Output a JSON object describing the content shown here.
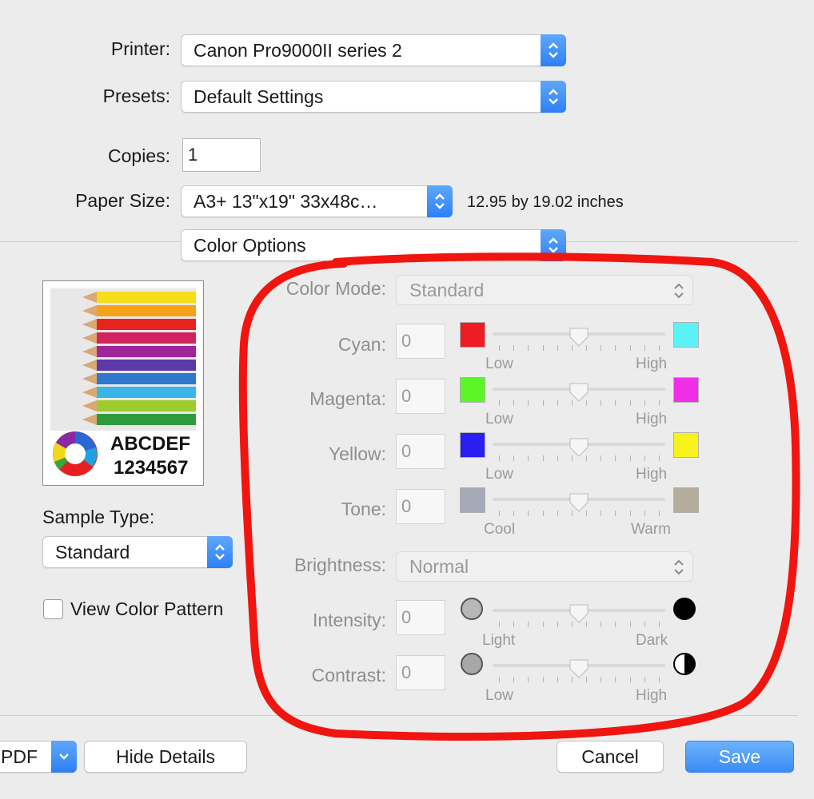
{
  "printer": {
    "label": "Printer:",
    "value": "Canon Pro9000II series 2"
  },
  "presets": {
    "label": "Presets:",
    "value": "Default Settings"
  },
  "copies": {
    "label": "Copies:",
    "value": "1"
  },
  "paper_size": {
    "label": "Paper Size:",
    "value": "A3+ 13\"x19\" 33x48c…",
    "dimensions": "12.95 by 19.02 inches"
  },
  "section_popup": {
    "value": "Color Options"
  },
  "preview": {
    "line1": "ABCDEF",
    "line2": "1234567"
  },
  "sample_type": {
    "label": "Sample Type:",
    "value": "Standard"
  },
  "view_color_pattern": {
    "label": "View Color Pattern",
    "checked": false
  },
  "color_mode": {
    "label": "Color Mode:",
    "value": "Standard"
  },
  "sliders": [
    {
      "label": "Cyan:",
      "value": "0",
      "low": "Low",
      "high": "High",
      "left_color": "#ee1c24",
      "right_color": "#5cf2f5"
    },
    {
      "label": "Magenta:",
      "value": "0",
      "low": "Low",
      "high": "High",
      "left_color": "#5cf526",
      "right_color": "#ee2fe6"
    },
    {
      "label": "Yellow:",
      "value": "0",
      "low": "Low",
      "high": "High",
      "left_color": "#2a1ef0",
      "right_color": "#f7f21c"
    },
    {
      "label": "Tone:",
      "value": "0",
      "low": "Cool",
      "high": "Warm",
      "left_color": "#a6aab8",
      "right_color": "#b5ad9c"
    }
  ],
  "brightness": {
    "label": "Brightness:",
    "value": "Normal"
  },
  "sliders2": [
    {
      "label": "Intensity:",
      "value": "0",
      "low": "Light",
      "high": "Dark"
    },
    {
      "label": "Contrast:",
      "value": "0",
      "low": "Low",
      "high": "High"
    }
  ],
  "buttons": {
    "pdf": "PDF",
    "hide_details": "Hide Details",
    "cancel": "Cancel",
    "save": "Save"
  },
  "colors": {
    "accent": "#3a8bf6",
    "annotation": "#f0150f"
  }
}
